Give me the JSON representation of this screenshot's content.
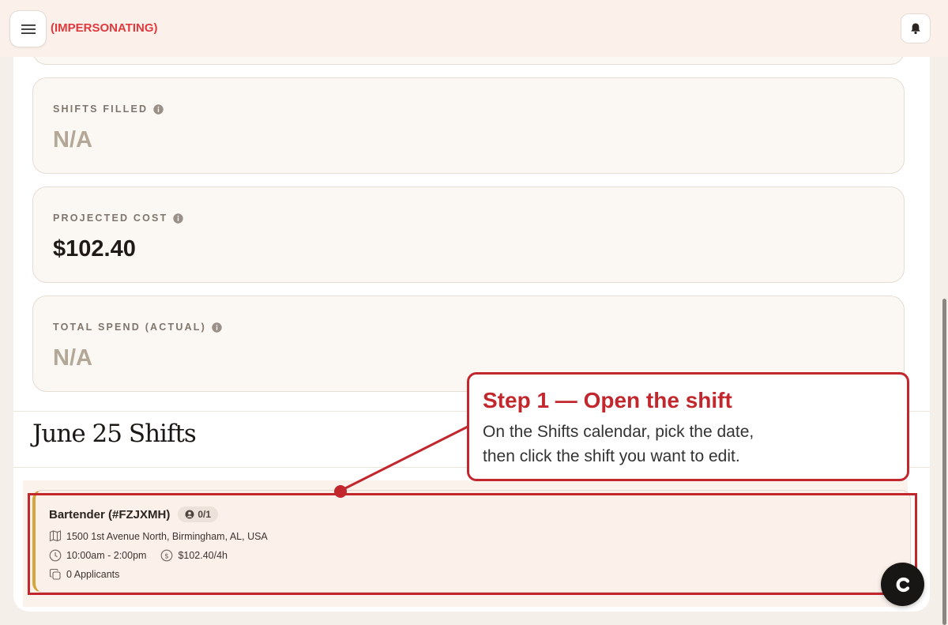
{
  "header": {
    "impersonating_label": "(IMPERSONATING)"
  },
  "stats": [
    {
      "label": "SHIFTS FILLED",
      "value": "N/A",
      "icon": "info-icon"
    },
    {
      "label": "PROJECTED COST",
      "value": "$102.40",
      "icon": "info-icon"
    },
    {
      "label": "TOTAL SPEND (ACTUAL)",
      "value": "N/A",
      "icon": "info-icon"
    }
  ],
  "shifts_section": {
    "title": "June 25 Shifts"
  },
  "shift": {
    "title": "Bartender (#FZJXMH)",
    "filled": "0/1",
    "address": "1500 1st Avenue North, Birmingham, AL, USA",
    "time": "10:00am - 2:00pm",
    "rate": "$102.40/4h",
    "applicants": "0 Applicants",
    "accent_color": "#d6a63c"
  },
  "annotation": {
    "title": "Step 1 — Open the shift",
    "line1": "On the Shifts calendar, pick the date,",
    "line2": "then click the shift you want to edit.",
    "color": "#c1272d"
  },
  "chat": {
    "icon": "chat-logo-icon"
  }
}
